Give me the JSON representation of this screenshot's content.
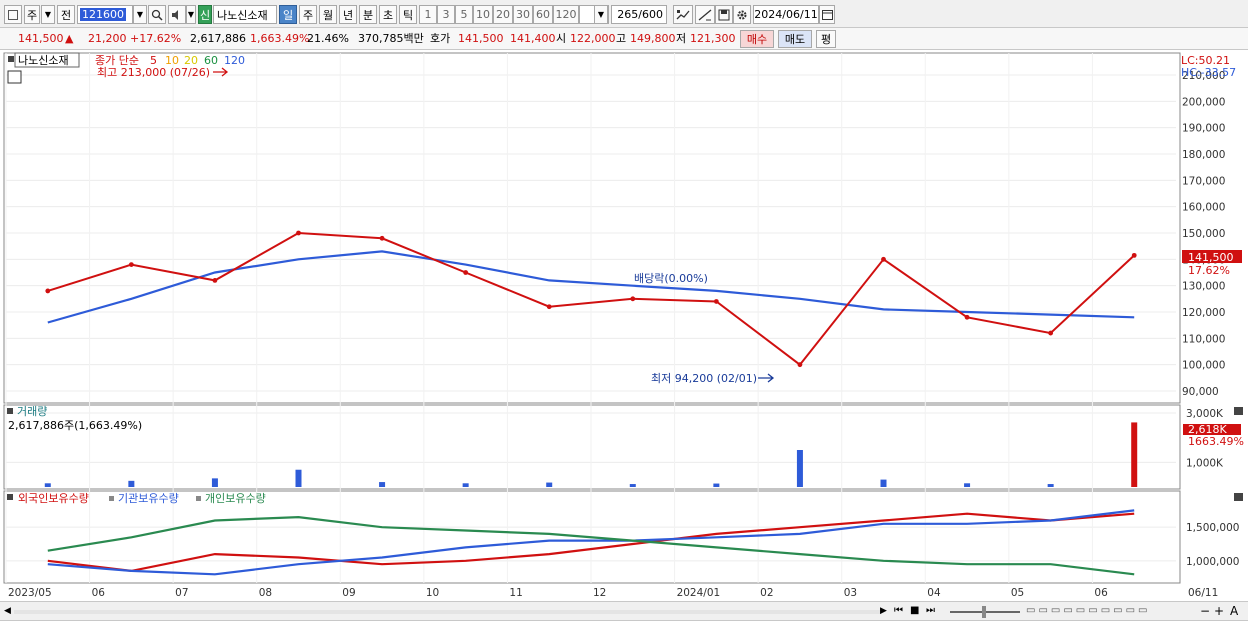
{
  "toolbar": {
    "period_prefix": "주",
    "prev_label": "전",
    "stock_code": "121600",
    "market_badge": "신",
    "stock_name": "나노신소재",
    "periods": [
      "일",
      "주",
      "월",
      "년",
      "분",
      "초",
      "틱"
    ],
    "selected_period": "일",
    "intervals": [
      "1",
      "3",
      "5",
      "10",
      "20",
      "30",
      "60",
      "120"
    ],
    "count_display": "265",
    "count_total": "/600",
    "date": "2024/06/11"
  },
  "info": {
    "price": "141,500",
    "change": "21,200",
    "change_pct": "+17.62%",
    "volume": "2,617,886",
    "volume_pct": "1,663.49%",
    "turnover": "21.46%",
    "amount": "370,785백만",
    "bid_ask_label": "호가",
    "ask": "141,500",
    "bid": "141,400",
    "open_label": "시",
    "open": "122,000",
    "high_label": "고",
    "high": "149,800",
    "low_label": "저",
    "low": "121,300",
    "buy_label": "매수",
    "sell_label": "매도",
    "eval_label": "평"
  },
  "price_panel": {
    "name_tag": "나노신소재",
    "legend_prefix": "종가 단순",
    "ma_periods": [
      "5",
      "10",
      "20",
      "60",
      "120"
    ],
    "ma_colors": [
      "#d01010",
      "#f08c00",
      "#f0e020",
      "#1a9040",
      "#2e5bd8"
    ],
    "high_note": "최고 213,000 (07/26)",
    "low_note": "최저 94,200 (02/01)",
    "dividend_note": "배당락(0.00%)",
    "lc": "LC:50.21",
    "hc": "HC:-33.57",
    "last_price": "141,500",
    "last_pct": "17.62%",
    "y_ticks": [
      "90,000",
      "100,000",
      "110,000",
      "120,000",
      "130,000",
      "140,000",
      "150,000",
      "160,000",
      "170,000",
      "180,000",
      "190,000",
      "200,000",
      "210,000"
    ]
  },
  "volume_panel": {
    "title": "거래량",
    "value": "2,617,886주(1,663.49%)",
    "y_ticks": [
      "1,000K",
      "3,000K"
    ],
    "last_value": "2,618K",
    "last_pct": "1663.49%"
  },
  "holding_panel": {
    "series": [
      "외국인보유수량",
      "기관보유수량",
      "개인보유수량"
    ],
    "series_colors": [
      "#d01010",
      "#2e5bd8",
      "#2a8a50"
    ],
    "y_ticks": [
      "1,000,000",
      "1,500,000"
    ]
  },
  "x_axis": {
    "labels": [
      "2023/05",
      "06",
      "07",
      "08",
      "09",
      "10",
      "11",
      "12",
      "2024/01",
      "02",
      "03",
      "04",
      "05",
      "06"
    ],
    "end_label": "06/11"
  },
  "chart_data": [
    {
      "type": "line",
      "title": "",
      "x": [
        "2023/05",
        "2023/06",
        "2023/07",
        "2023/08",
        "2023/09",
        "2023/10",
        "2023/11",
        "2023/12",
        "2024/01",
        "2024/02",
        "2024/03",
        "2024/04",
        "2024/05",
        "2024/06"
      ],
      "series": [
        {
          "name": "종가",
          "values": [
            128000,
            138000,
            132000,
            150000,
            148000,
            135000,
            122000,
            125000,
            124000,
            100000,
            140000,
            118000,
            112000,
            141500
          ]
        },
        {
          "name": "120",
          "values": [
            116000,
            125000,
            135000,
            140000,
            143000,
            138000,
            132000,
            130000,
            128000,
            125000,
            121000,
            120000,
            119000,
            118000
          ]
        }
      ],
      "ylim": [
        90000,
        210000
      ]
    },
    {
      "type": "bar",
      "title": "거래량",
      "x": [
        "2023/05",
        "2023/06",
        "2023/07",
        "2023/08",
        "2023/09",
        "2023/10",
        "2023/11",
        "2023/12",
        "2024/01",
        "2024/02",
        "2024/03",
        "2024/04",
        "2024/05",
        "2024/06"
      ],
      "values": [
        150000,
        250000,
        350000,
        700000,
        200000,
        150000,
        180000,
        120000,
        140000,
        1500000,
        300000,
        150000,
        120000,
        2617886
      ],
      "ylim": [
        0,
        3000000
      ]
    },
    {
      "type": "line",
      "title": "",
      "x": [
        "2023/05",
        "2023/06",
        "2023/07",
        "2023/08",
        "2023/09",
        "2023/10",
        "2023/11",
        "2023/12",
        "2024/01",
        "2024/02",
        "2024/03",
        "2024/04",
        "2024/05",
        "2024/06"
      ],
      "series": [
        {
          "name": "외국인보유수량",
          "values": [
            1000000,
            850000,
            1100000,
            1050000,
            950000,
            1000000,
            1100000,
            1250000,
            1400000,
            1500000,
            1600000,
            1700000,
            1600000,
            1700000
          ]
        },
        {
          "name": "기관보유수량",
          "values": [
            950000,
            850000,
            800000,
            950000,
            1050000,
            1200000,
            1300000,
            1300000,
            1350000,
            1400000,
            1550000,
            1550000,
            1600000,
            1750000
          ]
        },
        {
          "name": "개인보유수량",
          "values": [
            1150000,
            1350000,
            1600000,
            1650000,
            1500000,
            1450000,
            1400000,
            1300000,
            1200000,
            1100000,
            1000000,
            950000,
            950000,
            800000
          ]
        }
      ],
      "ylim": [
        700000,
        1800000
      ]
    }
  ]
}
